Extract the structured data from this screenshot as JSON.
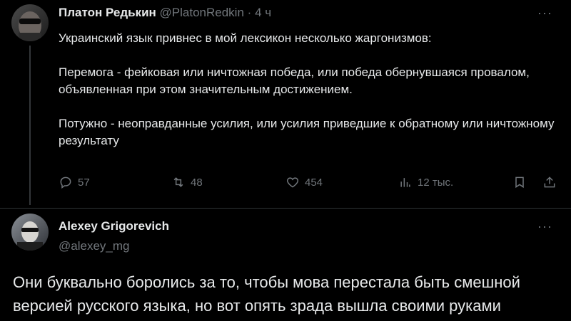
{
  "tweet1": {
    "author_name": "Платон Редькин",
    "author_handle": "@PlatonRedkin",
    "separator": "·",
    "time": "4 ч",
    "more": "···",
    "text": "Украинский язык привнес в мой лексикон несколько жаргонизмов:\n\nПеремога - фейковая или ничтожная победа, или победа обернувшаяся провалом, объявленная при этом значительным достижением.\n\nПотужно - неоправданные усилия, или усилия приведшие к обратному или ничтожному результату",
    "replies": "57",
    "retweets": "48",
    "likes": "454",
    "views": "12 тыс."
  },
  "tweet2": {
    "author_name": "Alexey Grigorevich",
    "author_handle": "@alexey_mg",
    "more": "···",
    "text": "Они буквально боролись за то, чтобы мова перестала быть смешной версией русского языка, но вот опять зрада вышла своими руками"
  },
  "icons": {
    "reply": "reply-icon",
    "retweet": "retweet-icon",
    "like": "heart-icon",
    "views": "views-icon",
    "bookmark": "bookmark-icon",
    "share": "share-icon"
  }
}
